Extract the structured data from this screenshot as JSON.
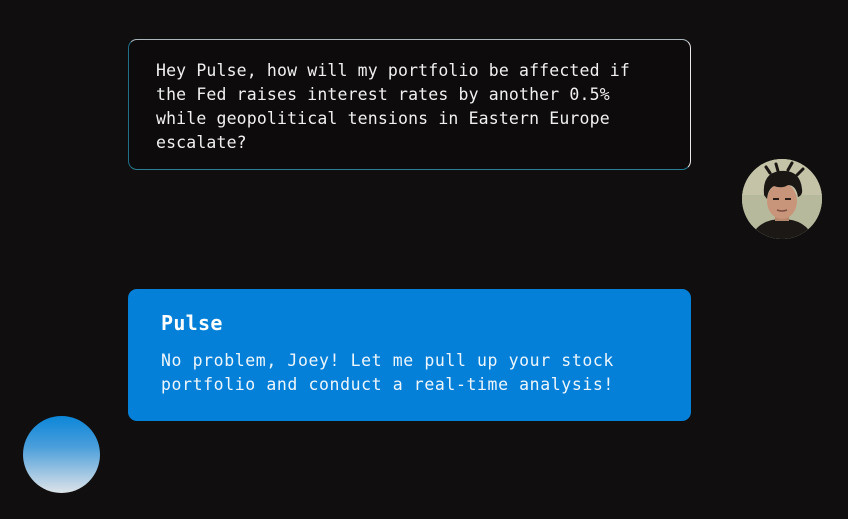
{
  "conversation": {
    "user_message": {
      "text": "Hey Pulse, how will my portfolio be affected if\nthe Fed raises interest rates by another 0.5%\nwhile geopolitical tensions in Eastern Europe\nescalate?",
      "avatar_icon": "user-photo-avatar"
    },
    "assistant_message": {
      "name": "Pulse",
      "text": "No problem, Joey! Let me pull up your stock\nportfolio and conduct a real-time analysis!",
      "avatar_icon": "gradient-orb-avatar"
    }
  },
  "colors": {
    "background": "#100e0e",
    "assistant_bubble": "#0580d8",
    "user_bubble_border": "#ece9ea",
    "text": "#f1f0f0"
  }
}
